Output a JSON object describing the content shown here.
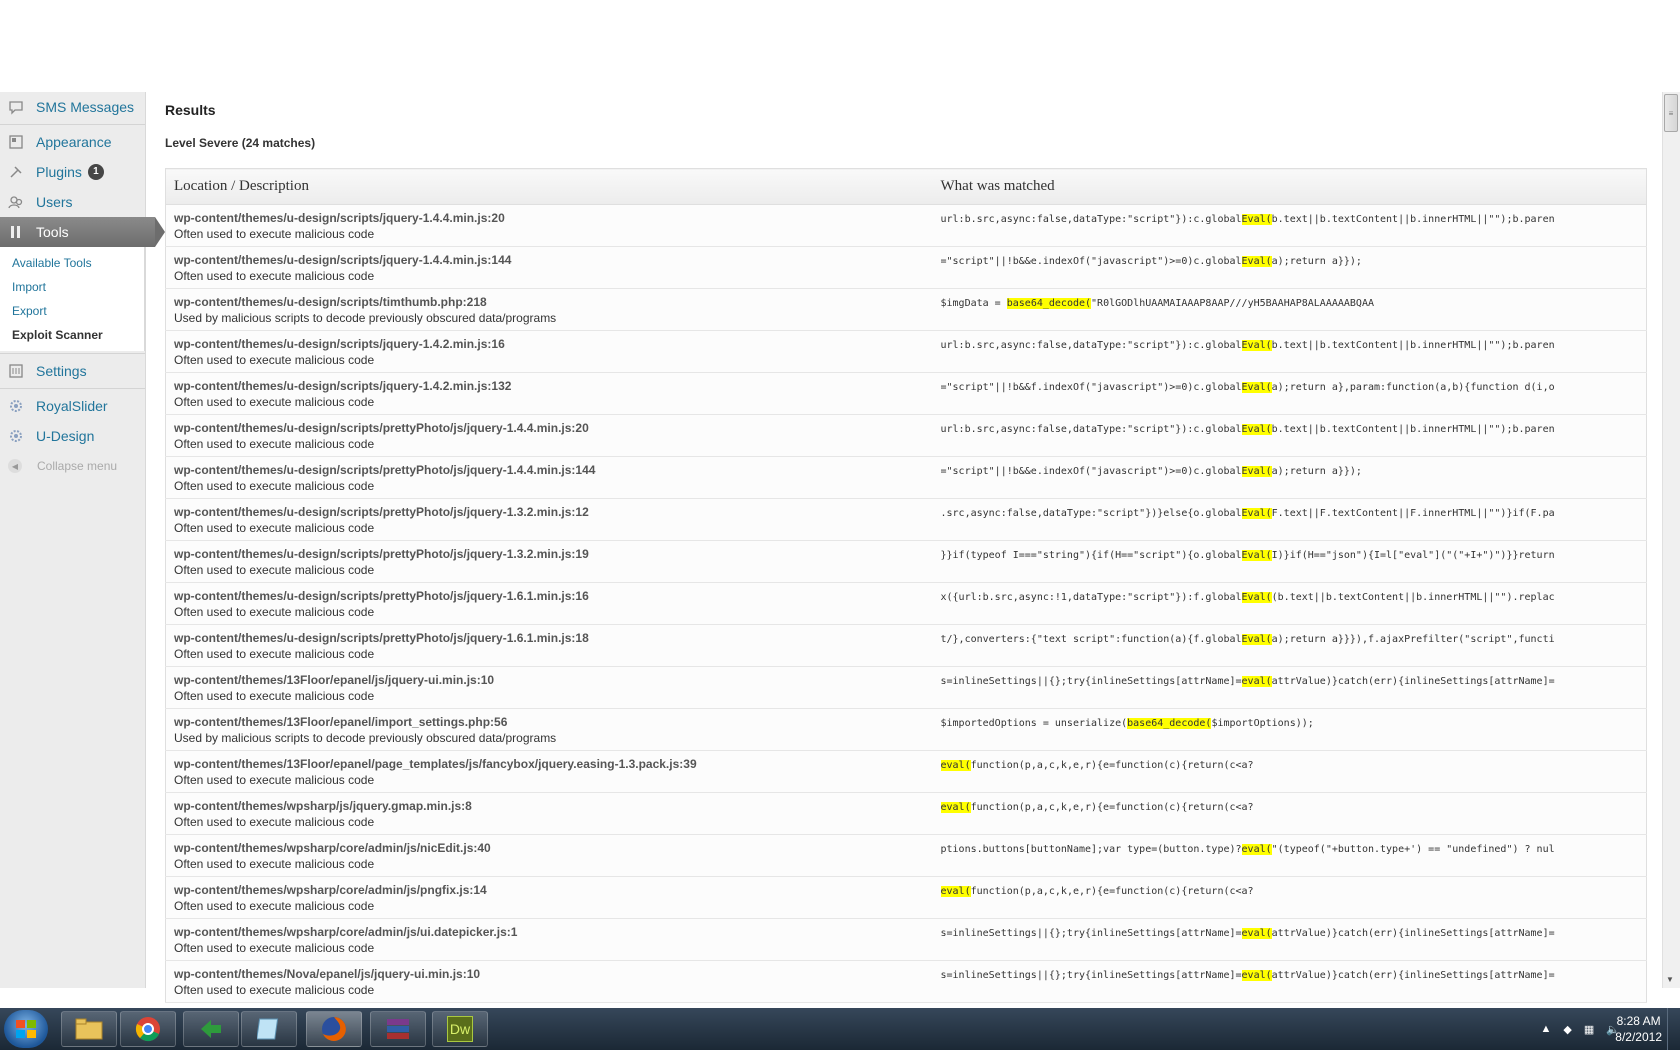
{
  "sidebar": {
    "items_top": [
      {
        "label": "SMS Messages",
        "icon": "speech-bubble-icon"
      },
      {
        "label": "Appearance",
        "icon": "appearance-icon"
      },
      {
        "label": "Plugins",
        "icon": "plug-icon",
        "badge": "1"
      },
      {
        "label": "Users",
        "icon": "users-icon"
      },
      {
        "label": "Tools",
        "icon": "tools-icon",
        "active": true
      }
    ],
    "tools_submenu": [
      "Available Tools",
      "Import",
      "Export",
      "Exploit Scanner"
    ],
    "items_bottom": [
      {
        "label": "Settings",
        "icon": "settings-icon"
      },
      {
        "label": "RoyalSlider",
        "icon": "gear-icon"
      },
      {
        "label": "U-Design",
        "icon": "gear-icon"
      }
    ],
    "collapse_label": "Collapse menu"
  },
  "main": {
    "title": "Results",
    "level_title": "Level Severe (24 matches)",
    "table": {
      "headers": [
        "Location / Description",
        "What was matched"
      ],
      "rows": [
        {
          "loc": "wp-content/themes/u-design/scripts/jquery-1.4.4.min.js:20",
          "desc": "Often used to execute malicious code",
          "pre": "url:b.src,async:false,dataType:\"script\"}):c.global",
          "hl": "Eval(",
          "post": "b.text||b.textContent||b.innerHTML||\"\");b.paren"
        },
        {
          "loc": "wp-content/themes/u-design/scripts/jquery-1.4.4.min.js:144",
          "desc": "Often used to execute malicious code",
          "pre": "=\"script\"||!b&&e.indexOf(\"javascript\")>=0)c.global",
          "hl": "Eval(",
          "post": "a);return a}});"
        },
        {
          "loc": "wp-content/themes/u-design/scripts/timthumb.php:218",
          "desc": "Used by malicious scripts to decode previously obscured data/programs",
          "pre": "$imgData = ",
          "hl": "base64_decode(",
          "post": "\"R0lGODlhUAAMAIAAAP8AAP///yH5BAAHAP8ALAAAAABQAA"
        },
        {
          "loc": "wp-content/themes/u-design/scripts/jquery-1.4.2.min.js:16",
          "desc": "Often used to execute malicious code",
          "pre": "url:b.src,async:false,dataType:\"script\"}):c.global",
          "hl": "Eval(",
          "post": "b.text||b.textContent||b.innerHTML||\"\");b.paren"
        },
        {
          "loc": "wp-content/themes/u-design/scripts/jquery-1.4.2.min.js:132",
          "desc": "Often used to execute malicious code",
          "pre": "=\"script\"||!b&&f.indexOf(\"javascript\")>=0)c.global",
          "hl": "Eval(",
          "post": "a);return a},param:function(a,b){function d(i,o"
        },
        {
          "loc": "wp-content/themes/u-design/scripts/prettyPhoto/js/jquery-1.4.4.min.js:20",
          "desc": "Often used to execute malicious code",
          "pre": "url:b.src,async:false,dataType:\"script\"}):c.global",
          "hl": "Eval(",
          "post": "b.text||b.textContent||b.innerHTML||\"\");b.paren"
        },
        {
          "loc": "wp-content/themes/u-design/scripts/prettyPhoto/js/jquery-1.4.4.min.js:144",
          "desc": "Often used to execute malicious code",
          "pre": "=\"script\"||!b&&e.indexOf(\"javascript\")>=0)c.global",
          "hl": "Eval(",
          "post": "a);return a}});"
        },
        {
          "loc": "wp-content/themes/u-design/scripts/prettyPhoto/js/jquery-1.3.2.min.js:12",
          "desc": "Often used to execute malicious code",
          "pre": ".src,async:false,dataType:\"script\"})}else{o.global",
          "hl": "Eval(",
          "post": "F.text||F.textContent||F.innerHTML||\"\")}if(F.pa"
        },
        {
          "loc": "wp-content/themes/u-design/scripts/prettyPhoto/js/jquery-1.3.2.min.js:19",
          "desc": "Often used to execute malicious code",
          "pre": "}}if(typeof I===\"string\"){if(H==\"script\"){o.global",
          "hl": "Eval(",
          "post": "I)}if(H==\"json\"){I=l[\"eval\"](\"(\"+I+\")\")}}return"
        },
        {
          "loc": "wp-content/themes/u-design/scripts/prettyPhoto/js/jquery-1.6.1.min.js:16",
          "desc": "Often used to execute malicious code",
          "pre": "x({url:b.src,async:!1,dataType:\"script\"}):f.global",
          "hl": "Eval(",
          "post": "(b.text||b.textContent||b.innerHTML||\"\").replac"
        },
        {
          "loc": "wp-content/themes/u-design/scripts/prettyPhoto/js/jquery-1.6.1.min.js:18",
          "desc": "Often used to execute malicious code",
          "pre": "t/},converters:{\"text script\":function(a){f.global",
          "hl": "Eval(",
          "post": "a);return a}}}),f.ajaxPrefilter(\"script\",functi"
        },
        {
          "loc": "wp-content/themes/13Floor/epanel/js/jquery-ui.min.js:10",
          "desc": "Often used to execute malicious code",
          "pre": "s=inlineSettings||{};try{inlineSettings[attrName]=",
          "hl": "eval(",
          "post": "attrValue)}catch(err){inlineSettings[attrName]="
        },
        {
          "loc": "wp-content/themes/13Floor/epanel/import_settings.php:56",
          "desc": "Used by malicious scripts to decode previously obscured data/programs",
          "pre": "$importedOptions = unserialize(",
          "hl": "base64_decode(",
          "post": "$importOptions));"
        },
        {
          "loc": "wp-content/themes/13Floor/epanel/page_templates/js/fancybox/jquery.easing-1.3.pack.js:39",
          "desc": "Often used to execute malicious code",
          "pre": "",
          "hl": "eval(",
          "post": "function(p,a,c,k,e,r){e=function(c){return(c<a?"
        },
        {
          "loc": "wp-content/themes/wpsharp/js/jquery.gmap.min.js:8",
          "desc": "Often used to execute malicious code",
          "pre": "",
          "hl": "eval(",
          "post": "function(p,a,c,k,e,r){e=function(c){return(c<a?"
        },
        {
          "loc": "wp-content/themes/wpsharp/core/admin/js/nicEdit.js:40",
          "desc": "Often used to execute malicious code",
          "pre": "ptions.buttons[buttonName];var type=(button.type)?",
          "hl": "eval(",
          "post": "\"(typeof(\"+button.type+') == \"undefined\") ? nul"
        },
        {
          "loc": "wp-content/themes/wpsharp/core/admin/js/pngfix.js:14",
          "desc": "Often used to execute malicious code",
          "pre": "",
          "hl": "eval(",
          "post": "function(p,a,c,k,e,r){e=function(c){return(c<a?"
        },
        {
          "loc": "wp-content/themes/wpsharp/core/admin/js/ui.datepicker.js:1",
          "desc": "Often used to execute malicious code",
          "pre": "s=inlineSettings||{};try{inlineSettings[attrName]=",
          "hl": "eval(",
          "post": "attrValue)}catch(err){inlineSettings[attrName]="
        },
        {
          "loc": "wp-content/themes/Nova/epanel/js/jquery-ui.min.js:10",
          "desc": "Often used to execute malicious code",
          "pre": "s=inlineSettings||{};try{inlineSettings[attrName]=",
          "hl": "eval(",
          "post": "attrValue)}catch(err){inlineSettings[attrName]="
        }
      ]
    }
  },
  "taskbar": {
    "apps": [
      "windows-explorer-icon",
      "chrome-icon",
      "green-arrow-app-icon",
      "notepad-icon",
      "firefox-icon",
      "winrar-icon",
      "dreamweaver-icon"
    ],
    "dreamweaver_label": "Dw",
    "clock_time": "8:28 AM",
    "clock_date": "8/2/2012"
  },
  "colors": {
    "highlight": "#ffff00",
    "link": "#21759b",
    "active_menu": "#6d6d6d"
  }
}
